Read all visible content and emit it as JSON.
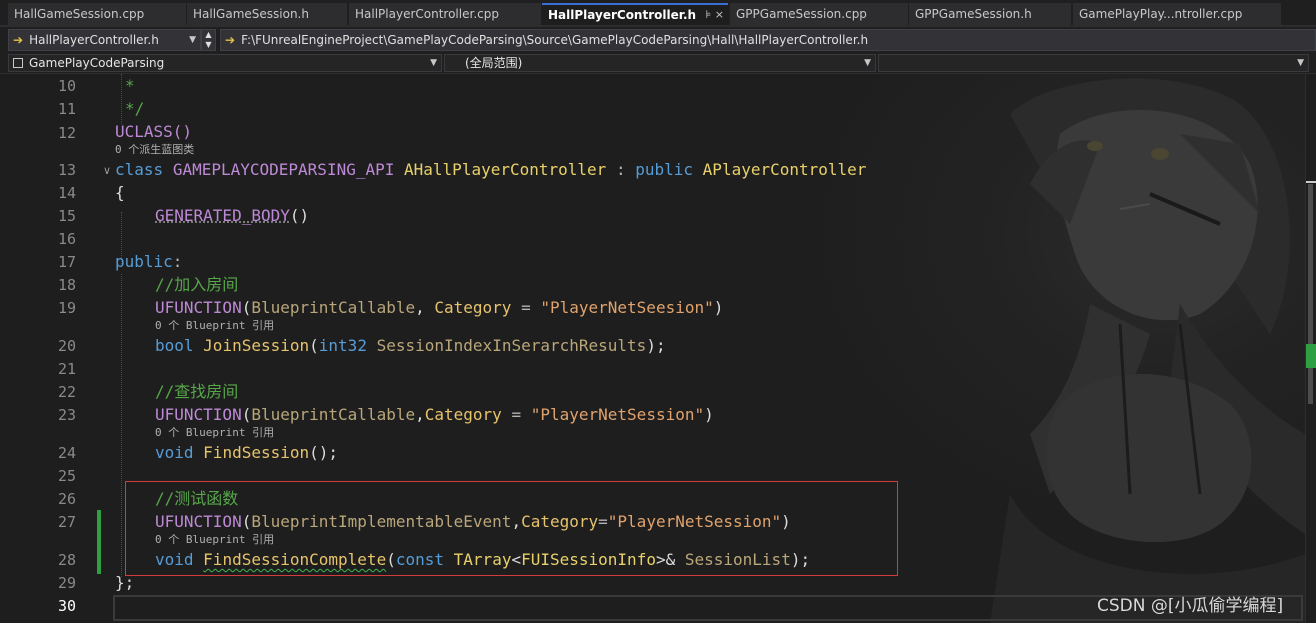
{
  "tabs": [
    {
      "label": "HallGameSession.cpp",
      "active": false
    },
    {
      "label": "HallGameSession.h",
      "active": false
    },
    {
      "label": "HallPlayerController.cpp",
      "active": false
    },
    {
      "label": "HallPlayerController.h",
      "active": true
    },
    {
      "label": "GPPGameSession.cpp",
      "active": false
    },
    {
      "label": "GPPGameSession.h",
      "active": false
    },
    {
      "label": "GamePlayPlay...ntroller.cpp",
      "active": false
    }
  ],
  "active_tab_icons": "⊧ ×",
  "navbar": {
    "file_combo": "HallPlayerController.h",
    "path": "F:\\FUnrealEngineProject\\GamePlayCodeParsing\\Source\\GamePlayCodeParsing\\Hall\\HallPlayerController.h"
  },
  "scopebar": {
    "project": "GamePlayCodeParsing",
    "scope": "(全局范围)",
    "member": ""
  },
  "code": {
    "line_numbers": [
      "10",
      "11",
      "12",
      "13",
      "14",
      "15",
      "16",
      "17",
      "18",
      "19",
      "20",
      "21",
      "22",
      "23",
      "24",
      "25",
      "26",
      "27",
      "28",
      "29",
      "30"
    ],
    "l10": "*",
    "l11": "*/",
    "l12": "UCLASS()",
    "hint_derived": "0 个派生蓝图类",
    "l13_kw": "class",
    "l13_api": "GAMEPLAYCODEPARSING_API",
    "l13_name": "AHallPlayerController",
    "l13_colon": ":",
    "l13_public": "public",
    "l13_base": "APlayerController",
    "l14": "{",
    "l15": "GENERATED_BODY",
    "l15_paren": "()",
    "l17_kw": "public",
    "l17_colon": ":",
    "l18": "//加入房间",
    "l19_macro": "UFUNCTION",
    "l19_p1": "(",
    "l19_arg": "BlueprintCallable",
    "l19_comma": ", ",
    "l19_cat": "Category",
    "l19_eq": " = ",
    "l19_str": "\"PlayerNetSeesion\"",
    "l19_p2": ")",
    "hint_bp": "0 个 Blueprint 引用",
    "l20_type": "bool",
    "l20_fn": "JoinSession",
    "l20_p1": "(",
    "l20_ptype": "int32",
    "l20_pname": "SessionIndexInSerarchResults",
    "l20_p2": ");",
    "l22": "//查找房间",
    "l23_macro": "UFUNCTION",
    "l23_p1": "(",
    "l23_arg": "BlueprintCallable",
    "l23_comma": ",",
    "l23_cat": "Category",
    "l23_eq": " = ",
    "l23_str": "\"PlayerNetSession\"",
    "l23_p2": ")",
    "l24_type": "void",
    "l24_fn": "FindSession",
    "l24_rest": "();",
    "l26": "//测试函数",
    "l27_macro": "UFUNCTION",
    "l27_p1": "(",
    "l27_arg": "BlueprintImplementableEvent",
    "l27_comma": ",",
    "l27_cat": "Category",
    "l27_eq": "=",
    "l27_str": "\"PlayerNetSession\"",
    "l27_p2": ")",
    "l28_type": "void",
    "l28_fn": "FindSessionComplete",
    "l28_p1": "(",
    "l28_const": "const",
    "l28_tarray": "TArray",
    "l28_lt": "<",
    "l28_inner": "FUISessionInfo",
    "l28_gt": ">&",
    "l28_pname": "SessionList",
    "l28_p2": ");",
    "l29": "};"
  },
  "watermark": "CSDN @[小瓜偷学编程]",
  "colors": {
    "keyword": "#569cd6",
    "macro": "#be89d6",
    "type": "#e8d16a",
    "function": "#e7c36c",
    "string": "#e0a36d",
    "comment": "#57a64a",
    "highlight_box": "#d23c3c",
    "change_bar": "#2ea043"
  },
  "icons": [
    "arrow-right-icon",
    "chevron-down-icon",
    "spin-updown-icon",
    "project-square-icon",
    "collapse-icon",
    "close-icon",
    "pin-icon"
  ]
}
